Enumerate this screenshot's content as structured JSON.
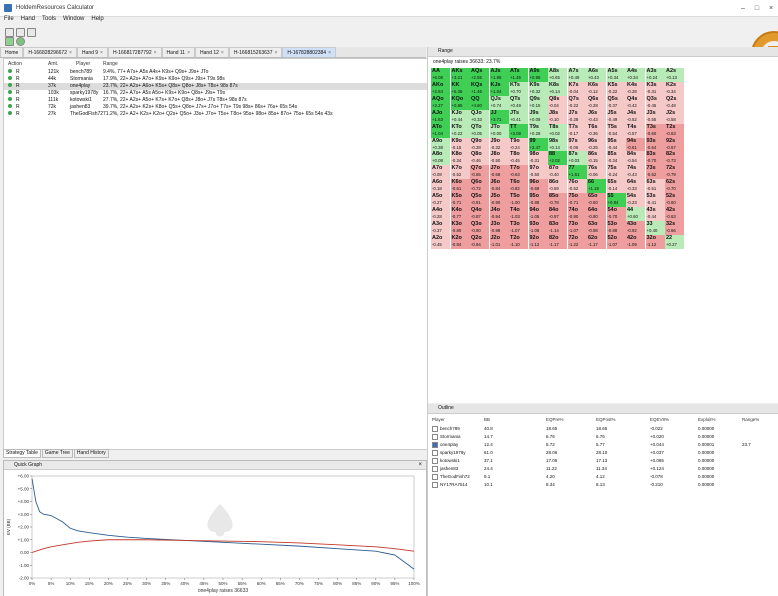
{
  "window": {
    "title": "HoldemResources Calculator"
  },
  "menu": [
    "File",
    "Hand",
    "Tools",
    "Window",
    "Help"
  ],
  "tabs": [
    "Home",
    "H-166828296672",
    "Hand 9",
    "H-166817287792",
    "Hand 11",
    "Hand 12",
    "H-166815263637",
    "H-167828802384"
  ],
  "active_tab_index": 7,
  "hand_table": {
    "headers": {
      "action": "Action",
      "amt": "Amt.",
      "player": "Player",
      "range": "Range"
    },
    "rows": [
      {
        "action": "R",
        "amt": "121k",
        "player": "bench789",
        "range": "9.4%, 77+ A7s+ A5s A4s+ K9s+ Q9s+ J9s+ JTo"
      },
      {
        "action": "R",
        "amt": "44k",
        "player": "Stormania",
        "range": "17.9%, 22+ A2s+ A7o+ K9s+ K9o+ Q9s+ J9s+ T9s 98s"
      },
      {
        "action": "R",
        "amt": "37k",
        "player": "one4play",
        "range": "23.7%, 22+ A2s+ A6o+ K5s+ Q8s+ Q8o+ J8s+ T8s+ 98s 87s"
      },
      {
        "action": "R",
        "amt": "103k",
        "player": "sparky1978y",
        "range": "16.7%, 22+ A7s+ A5s A5o+ K9s+ K9o+ Q8s+ J9s+ T9s"
      },
      {
        "action": "R",
        "amt": "111k",
        "player": "kotowski1",
        "range": "27.7%, 22+ A2s+ A5o+ K7s+ K7o+ Q8s+ J8o+ J7s T8s+ 98s 87s"
      },
      {
        "action": "R",
        "amt": "72k",
        "player": "jashen83",
        "range": "39.7%, 22+ A2s+ K2s+ K8o+ Q5s+ Q8o+ J7s+ J7o+ T7s+ T9s 98s+ 86s+ 76s+ 65s 54s"
      },
      {
        "action": "R",
        "amt": "27k",
        "player": "TheGodFish72",
        "range": "71.2%, 22+ A2+ K2s+ K2o+ Q2s+ Q5o+ J3s+ J7o+ T5s+ T8o+ 95s+ 98o+ 85s+ 87o+ 75s+ 65s 54s 43s"
      }
    ],
    "selected_row": 2
  },
  "bottom_tabs": [
    "Strategy Table",
    "Game Tree",
    "Hand History"
  ],
  "quick_graph": {
    "title": "Quick Graph",
    "ylabel": "EV (BB)",
    "xlabel": "one4play raises 36633",
    "y_ticks": [
      "+6.00",
      "+5.00",
      "+4.00",
      "+3.00",
      "+2.00",
      "+1.00",
      "0.00",
      "-1.00",
      "-2.00"
    ],
    "x_ticks": [
      "0%",
      "5%",
      "10%",
      "15%",
      "20%",
      "25%",
      "30%",
      "35%",
      "40%",
      "45%",
      "50%",
      "55%",
      "60%",
      "65%",
      "70%",
      "75%",
      "80%",
      "85%",
      "90%",
      "95%",
      "100%"
    ]
  },
  "chart_data": {
    "type": "line",
    "x": [
      0,
      1,
      2,
      3,
      5,
      8,
      10,
      12,
      15,
      20,
      25,
      30,
      40,
      50,
      60,
      70,
      80,
      90,
      95,
      100
    ],
    "series": [
      {
        "color": "#2b5d8f",
        "values": [
          5.8,
          4.0,
          3.2,
          3.0,
          2.9,
          2.4,
          1.9,
          1.7,
          1.55,
          1.35,
          1.2,
          1.1,
          0.95,
          0.8,
          0.65,
          0.5,
          0.3,
          0.1,
          -0.2,
          -1.3
        ]
      },
      {
        "color": "#c0392b",
        "values": [
          0.0,
          0.1,
          0.2,
          0.3,
          0.45,
          0.6,
          0.7,
          0.8,
          0.9,
          1.0,
          1.0,
          1.0,
          0.95,
          0.9,
          0.85,
          0.75,
          0.6,
          0.45,
          0.3,
          0.1
        ]
      }
    ],
    "xlabel": "one4play raises 36633",
    "ylabel": "EV (BB)",
    "ylim": [
      -2,
      6
    ],
    "xlim": [
      0,
      100
    ]
  },
  "range_panel": {
    "title": "Range",
    "subtitle": "one4play raises 36633: 23.7%",
    "grid": [
      [
        [
          "AA",
          "+6.08"
        ],
        [
          "AKs",
          "+3.21"
        ],
        [
          "AQs",
          "+2.55"
        ],
        [
          "AJs",
          "+1.95"
        ],
        [
          "ATs",
          "+1.45"
        ],
        [
          "A9s",
          "+0.95"
        ],
        [
          "A8s",
          "+0.65"
        ],
        [
          "A7s",
          "+0.49"
        ],
        [
          "A6s",
          "+0.43"
        ],
        [
          "A5s",
          "+0.34"
        ],
        [
          "A4s",
          "+0.34"
        ],
        [
          "A3s",
          "+0.24"
        ],
        [
          "A2s",
          "+0.13"
        ]
      ],
      [
        [
          "AKo",
          "+2.84"
        ],
        [
          "KK",
          "+5.36"
        ],
        [
          "KQs",
          "+1.46"
        ],
        [
          "KJs",
          "+1.04"
        ],
        [
          "KTs",
          "+0.70"
        ],
        [
          "K9s",
          "+0.32"
        ],
        [
          "K8s",
          "+0.14"
        ],
        [
          "K7s",
          "-0.04"
        ],
        [
          "K6s",
          "-0.12"
        ],
        [
          "K5s",
          "-0.22"
        ],
        [
          "K4s",
          "-0.28"
        ],
        [
          "K3s",
          "-0.31"
        ],
        [
          "K2s",
          "-0.34"
        ]
      ],
      [
        [
          "AQo",
          "+2.27"
        ],
        [
          "KQo",
          "+0.86"
        ],
        [
          "QQ",
          "+4.60"
        ],
        [
          "QJs",
          "+0.74"
        ],
        [
          "QTs",
          "+0.49"
        ],
        [
          "Q9s",
          "+0.15"
        ],
        [
          "Q8s",
          "-0.04"
        ],
        [
          "Q7s",
          "-0.22"
        ],
        [
          "Q6s",
          "-0.28"
        ],
        [
          "Q5s",
          "-0.37"
        ],
        [
          "Q4s",
          "-0.42"
        ],
        [
          "Q3s",
          "-0.45"
        ],
        [
          "Q2s",
          "-0.48"
        ]
      ],
      [
        [
          "AJo",
          "+1.63"
        ],
        [
          "KJo",
          "+0.44"
        ],
        [
          "QJo",
          "+0.33"
        ],
        [
          "JJ",
          "+3.71"
        ],
        [
          "JTs",
          "+0.41"
        ],
        [
          "J9s",
          "+0.08"
        ],
        [
          "J8s",
          "-0.10"
        ],
        [
          "J7s",
          "-0.28"
        ],
        [
          "J6s",
          "-0.43"
        ],
        [
          "J5s",
          "-0.49"
        ],
        [
          "J4s",
          "-0.52"
        ],
        [
          "J3s",
          "-0.55"
        ],
        [
          "J2s",
          "-0.58"
        ]
      ],
      [
        [
          "ATo",
          "+1.04"
        ],
        [
          "KTo",
          "+0.22"
        ],
        [
          "QTo",
          "+0.05"
        ],
        [
          "JTo",
          "+0.00"
        ],
        [
          "TT",
          "+3.08"
        ],
        [
          "T9s",
          "+0.28"
        ],
        [
          "T8s",
          "+0.02"
        ],
        [
          "T7s",
          "-0.17"
        ],
        [
          "T6s",
          "-0.36"
        ],
        [
          "T5s",
          "-0.54"
        ],
        [
          "T4s",
          "-0.57"
        ],
        [
          "T3s",
          "-0.60"
        ],
        [
          "T2s",
          "-0.63"
        ]
      ],
      [
        [
          "A9o",
          "+0.38"
        ],
        [
          "K9o",
          "-0.15"
        ],
        [
          "Q9o",
          "-0.28"
        ],
        [
          "J9o",
          "-0.32"
        ],
        [
          "T9o",
          "-0.24"
        ],
        [
          "99",
          "+2.47"
        ],
        [
          "98s",
          "+0.14"
        ],
        [
          "97s",
          "-0.06"
        ],
        [
          "96s",
          "-0.25"
        ],
        [
          "95s",
          "-0.44"
        ],
        [
          "94s",
          "-0.61"
        ],
        [
          "93s",
          "-0.64"
        ],
        [
          "92s",
          "-0.67"
        ]
      ],
      [
        [
          "A8o",
          "+0.08"
        ],
        [
          "K8o",
          "-0.34"
        ],
        [
          "Q8o",
          "-0.46"
        ],
        [
          "J8o",
          "-0.50"
        ],
        [
          "T8o",
          "-0.45"
        ],
        [
          "98o",
          "-0.31"
        ],
        [
          "88",
          "+2.02"
        ],
        [
          "87s",
          "+0.03"
        ],
        [
          "86s",
          "-0.15"
        ],
        [
          "85s",
          "-0.34"
        ],
        [
          "84s",
          "-0.54"
        ],
        [
          "83s",
          "-0.70"
        ],
        [
          "82s",
          "-0.73"
        ]
      ],
      [
        [
          "A7o",
          "-0.08"
        ],
        [
          "K7o",
          "-0.52"
        ],
        [
          "Q7o",
          "-0.65"
        ],
        [
          "J7o",
          "-0.68"
        ],
        [
          "T7o",
          "-0.63"
        ],
        [
          "97o",
          "-0.50"
        ],
        [
          "87o",
          "-0.40"
        ],
        [
          "77",
          "+1.61"
        ],
        [
          "76s",
          "-0.06"
        ],
        [
          "75s",
          "-0.24"
        ],
        [
          "74s",
          "-0.43"
        ],
        [
          "73s",
          "-0.62"
        ],
        [
          "72s",
          "-0.79"
        ]
      ],
      [
        [
          "A6o",
          "-0.18"
        ],
        [
          "K6o",
          "-0.61"
        ],
        [
          "Q6o",
          "-0.72"
        ],
        [
          "J6o",
          "-0.84"
        ],
        [
          "T6o",
          "-0.82"
        ],
        [
          "96o",
          "-0.69"
        ],
        [
          "86o",
          "-0.59"
        ],
        [
          "76o",
          "-0.52"
        ],
        [
          "66",
          "+1.19"
        ],
        [
          "65s",
          "-0.14"
        ],
        [
          "64s",
          "-0.33"
        ],
        [
          "63s",
          "-0.51"
        ],
        [
          "62s",
          "-0.70"
        ]
      ],
      [
        [
          "A5o",
          "-0.27"
        ],
        [
          "K5o",
          "-0.71"
        ],
        [
          "Q5o",
          "-0.81"
        ],
        [
          "J5o",
          "-0.90"
        ],
        [
          "T5o",
          "-1.00"
        ],
        [
          "95o",
          "-0.88"
        ],
        [
          "85o",
          "-0.78"
        ],
        [
          "75o",
          "-0.71"
        ],
        [
          "65o",
          "-0.60"
        ],
        [
          "55",
          "+0.84"
        ],
        [
          "54s",
          "-0.23"
        ],
        [
          "53s",
          "-0.41"
        ],
        [
          "52s",
          "-0.60"
        ]
      ],
      [
        [
          "A4o",
          "-0.28"
        ],
        [
          "K4o",
          "-0.77"
        ],
        [
          "Q4o",
          "-0.87"
        ],
        [
          "J4o",
          "-0.94"
        ],
        [
          "T4o",
          "-1.03"
        ],
        [
          "94o",
          "-1.05"
        ],
        [
          "84o",
          "-0.97"
        ],
        [
          "74o",
          "-0.90"
        ],
        [
          "64o",
          "-0.80"
        ],
        [
          "54o",
          "-0.70"
        ],
        [
          "44",
          "+0.60"
        ],
        [
          "43s",
          "-0.44"
        ],
        [
          "42s",
          "-0.63"
        ]
      ],
      [
        [
          "A3o",
          "-0.37"
        ],
        [
          "K3o",
          "-0.80"
        ],
        [
          "Q3o",
          "-0.90"
        ],
        [
          "J3o",
          "-0.98"
        ],
        [
          "T3o",
          "-1.07"
        ],
        [
          "93o",
          "-1.08"
        ],
        [
          "83o",
          "-1.14"
        ],
        [
          "73o",
          "-1.07"
        ],
        [
          "63o",
          "-0.98"
        ],
        [
          "53o",
          "-0.88"
        ],
        [
          "43o",
          "-0.92"
        ],
        [
          "33",
          "+0.40"
        ],
        [
          "32s",
          "-0.66"
        ]
      ],
      [
        [
          "A2o",
          "-0.45"
        ],
        [
          "K2o",
          "-0.84"
        ],
        [
          "Q2o",
          "-0.94"
        ],
        [
          "J2o",
          "-1.01"
        ],
        [
          "T2o",
          "-1.10"
        ],
        [
          "92o",
          "-1.12"
        ],
        [
          "82o",
          "-1.17"
        ],
        [
          "72o",
          "-1.22"
        ],
        [
          "62o",
          "-1.17"
        ],
        [
          "52o",
          "-1.07"
        ],
        [
          "42o",
          "-1.09"
        ],
        [
          "32o",
          "-1.12"
        ],
        [
          "22",
          "+0.27"
        ]
      ]
    ]
  },
  "outline": {
    "title": "Outline",
    "headers": [
      "Player",
      "BB",
      "EQPre%",
      "EQPost%",
      "EQEV8%",
      "Exploit%",
      "Range%"
    ],
    "rows": [
      {
        "player": "bench789",
        "bb": "40.8",
        "eqpre": "18.65",
        "eqpost": "18.65",
        "eqev": "-0.022",
        "exploit": "0.00000",
        "range": "",
        "checked": false
      },
      {
        "player": "Stormania",
        "bb": "14.7",
        "eqpre": "6.76",
        "eqpost": "6.76",
        "eqev": "+0.020",
        "exploit": "0.00000",
        "range": "",
        "checked": false
      },
      {
        "player": "one4play",
        "bb": "12.4",
        "eqpre": "5.72",
        "eqpost": "5.77",
        "eqev": "+0.044",
        "exploit": "0.00001",
        "range": "23.7",
        "checked": true
      },
      {
        "player": "sparky1978y",
        "bb": "61.0",
        "eqpre": "28.06",
        "eqpost": "28.10",
        "eqev": "+0.037",
        "exploit": "0.00000",
        "range": "",
        "checked": false
      },
      {
        "player": "kotowski1",
        "bb": "37.1",
        "eqpre": "17.05",
        "eqpost": "17.13",
        "eqev": "+0.085",
        "exploit": "0.00000",
        "range": "",
        "checked": false
      },
      {
        "player": "jashen83",
        "bb": "24.4",
        "eqpre": "11.22",
        "eqpost": "11.34",
        "eqev": "+0.124",
        "exploit": "0.00000",
        "range": "",
        "checked": false
      },
      {
        "player": "TheGodFish72",
        "bb": "9.1",
        "eqpre": "4.20",
        "eqpost": "4.12",
        "eqev": "-0.078",
        "exploit": "0.00000",
        "range": "",
        "checked": false
      },
      {
        "player": "NY17RA7514",
        "bb": "10.1",
        "eqpre": "8.34",
        "eqpost": "8.13",
        "eqev": "-0.210",
        "exploit": "0.00000",
        "range": "",
        "checked": false
      }
    ]
  },
  "colors": {
    "green_strong": "#3fcf55",
    "green_light": "#b9ebb9",
    "red_light": "#f6c9c9",
    "red_mid": "#ee9e9e"
  }
}
